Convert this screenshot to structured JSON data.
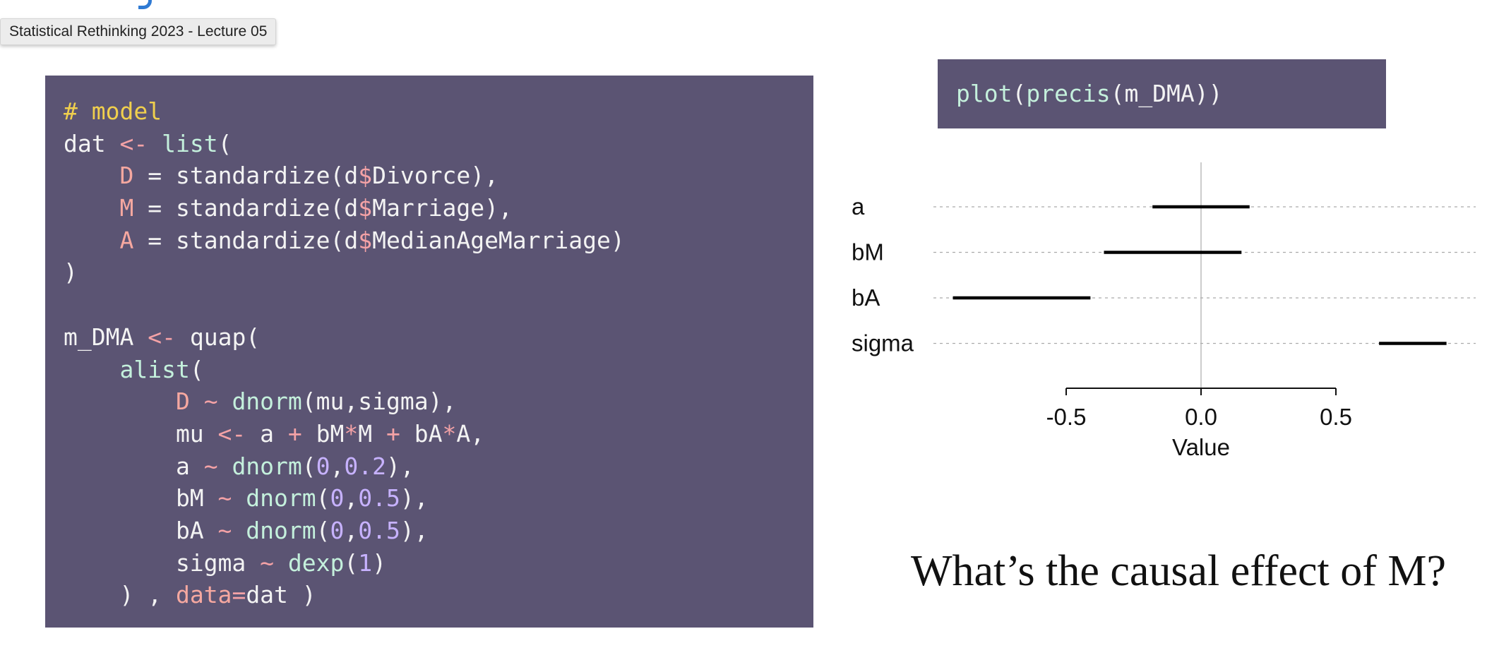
{
  "tooltip": "Statistical Rethinking 2023 - Lecture 05",
  "code": {
    "lines": [
      [
        {
          "t": "# model",
          "c": "comment"
        }
      ],
      [
        {
          "t": "dat ",
          "c": "plain"
        },
        {
          "t": "<-",
          "c": "op"
        },
        {
          "t": " ",
          "c": "plain"
        },
        {
          "t": "list",
          "c": "fn"
        },
        {
          "t": "(",
          "c": "plain"
        }
      ],
      [
        {
          "t": "    ",
          "c": "plain"
        },
        {
          "t": "D",
          "c": "var"
        },
        {
          "t": " = standardize(d",
          "c": "plain"
        },
        {
          "t": "$",
          "c": "op"
        },
        {
          "t": "Divorce),",
          "c": "plain"
        }
      ],
      [
        {
          "t": "    ",
          "c": "plain"
        },
        {
          "t": "M",
          "c": "var"
        },
        {
          "t": " = standardize(d",
          "c": "plain"
        },
        {
          "t": "$",
          "c": "op"
        },
        {
          "t": "Marriage),",
          "c": "plain"
        }
      ],
      [
        {
          "t": "    ",
          "c": "plain"
        },
        {
          "t": "A",
          "c": "var"
        },
        {
          "t": " = standardize(d",
          "c": "plain"
        },
        {
          "t": "$",
          "c": "op"
        },
        {
          "t": "MedianAgeMarriage)",
          "c": "plain"
        }
      ],
      [
        {
          "t": ")",
          "c": "plain"
        }
      ],
      [
        {
          "t": "",
          "c": "plain"
        }
      ],
      [
        {
          "t": "m_DMA ",
          "c": "plain"
        },
        {
          "t": "<-",
          "c": "op"
        },
        {
          "t": " quap(",
          "c": "plain"
        }
      ],
      [
        {
          "t": "    ",
          "c": "plain"
        },
        {
          "t": "alist",
          "c": "fn"
        },
        {
          "t": "(",
          "c": "plain"
        }
      ],
      [
        {
          "t": "        ",
          "c": "plain"
        },
        {
          "t": "D",
          "c": "var"
        },
        {
          "t": " ~ ",
          "c": "op"
        },
        {
          "t": "dnorm",
          "c": "fn"
        },
        {
          "t": "(mu,sigma),",
          "c": "plain"
        }
      ],
      [
        {
          "t": "        mu ",
          "c": "plain"
        },
        {
          "t": "<-",
          "c": "op"
        },
        {
          "t": " a ",
          "c": "plain"
        },
        {
          "t": "+",
          "c": "op"
        },
        {
          "t": " bM",
          "c": "plain"
        },
        {
          "t": "*",
          "c": "op"
        },
        {
          "t": "M ",
          "c": "plain"
        },
        {
          "t": "+",
          "c": "op"
        },
        {
          "t": " bA",
          "c": "plain"
        },
        {
          "t": "*",
          "c": "op"
        },
        {
          "t": "A,",
          "c": "plain"
        }
      ],
      [
        {
          "t": "        a ",
          "c": "plain"
        },
        {
          "t": "~",
          "c": "op"
        },
        {
          "t": " ",
          "c": "plain"
        },
        {
          "t": "dnorm",
          "c": "fn"
        },
        {
          "t": "(",
          "c": "plain"
        },
        {
          "t": "0",
          "c": "num"
        },
        {
          "t": ",",
          "c": "plain"
        },
        {
          "t": "0.2",
          "c": "num"
        },
        {
          "t": "),",
          "c": "plain"
        }
      ],
      [
        {
          "t": "        bM ",
          "c": "plain"
        },
        {
          "t": "~",
          "c": "op"
        },
        {
          "t": " ",
          "c": "plain"
        },
        {
          "t": "dnorm",
          "c": "fn"
        },
        {
          "t": "(",
          "c": "plain"
        },
        {
          "t": "0",
          "c": "num"
        },
        {
          "t": ",",
          "c": "plain"
        },
        {
          "t": "0.5",
          "c": "num"
        },
        {
          "t": "),",
          "c": "plain"
        }
      ],
      [
        {
          "t": "        bA ",
          "c": "plain"
        },
        {
          "t": "~",
          "c": "op"
        },
        {
          "t": " ",
          "c": "plain"
        },
        {
          "t": "dnorm",
          "c": "fn"
        },
        {
          "t": "(",
          "c": "plain"
        },
        {
          "t": "0",
          "c": "num"
        },
        {
          "t": ",",
          "c": "plain"
        },
        {
          "t": "0.5",
          "c": "num"
        },
        {
          "t": "),",
          "c": "plain"
        }
      ],
      [
        {
          "t": "        sigma ",
          "c": "plain"
        },
        {
          "t": "~",
          "c": "op"
        },
        {
          "t": " ",
          "c": "plain"
        },
        {
          "t": "dexp",
          "c": "fn"
        },
        {
          "t": "(",
          "c": "plain"
        },
        {
          "t": "1",
          "c": "num"
        },
        {
          "t": ")",
          "c": "plain"
        }
      ],
      [
        {
          "t": "    ) , ",
          "c": "plain"
        },
        {
          "t": "data",
          "c": "var"
        },
        {
          "t": "=",
          "c": "op"
        },
        {
          "t": "dat )",
          "c": "plain"
        }
      ]
    ]
  },
  "command": [
    {
      "t": "plot",
      "c": "fn"
    },
    {
      "t": "(",
      "c": "plain"
    },
    {
      "t": "precis",
      "c": "fn"
    },
    {
      "t": "(m_DMA))",
      "c": "plain"
    }
  ],
  "chart_data": {
    "type": "interval",
    "xlabel": "Value",
    "ylabel": "",
    "xlim": [
      -0.93,
      1.0
    ],
    "ticks": [
      -0.5,
      0.0,
      0.5
    ],
    "tick_labels": [
      "-0.5",
      "0.0",
      "0.5"
    ],
    "zero_line": true,
    "series": [
      {
        "name": "a",
        "lower": -0.18,
        "upper": 0.18
      },
      {
        "name": "bM",
        "lower": -0.36,
        "upper": 0.15
      },
      {
        "name": "bA",
        "lower": -0.92,
        "upper": -0.41
      },
      {
        "name": "sigma",
        "lower": 0.66,
        "upper": 0.91
      }
    ],
    "colors": {
      "interval": "#000000",
      "guide": "#aaaaaa",
      "zero": "#cccccc"
    }
  },
  "question": "What’s the causal effect of M?"
}
